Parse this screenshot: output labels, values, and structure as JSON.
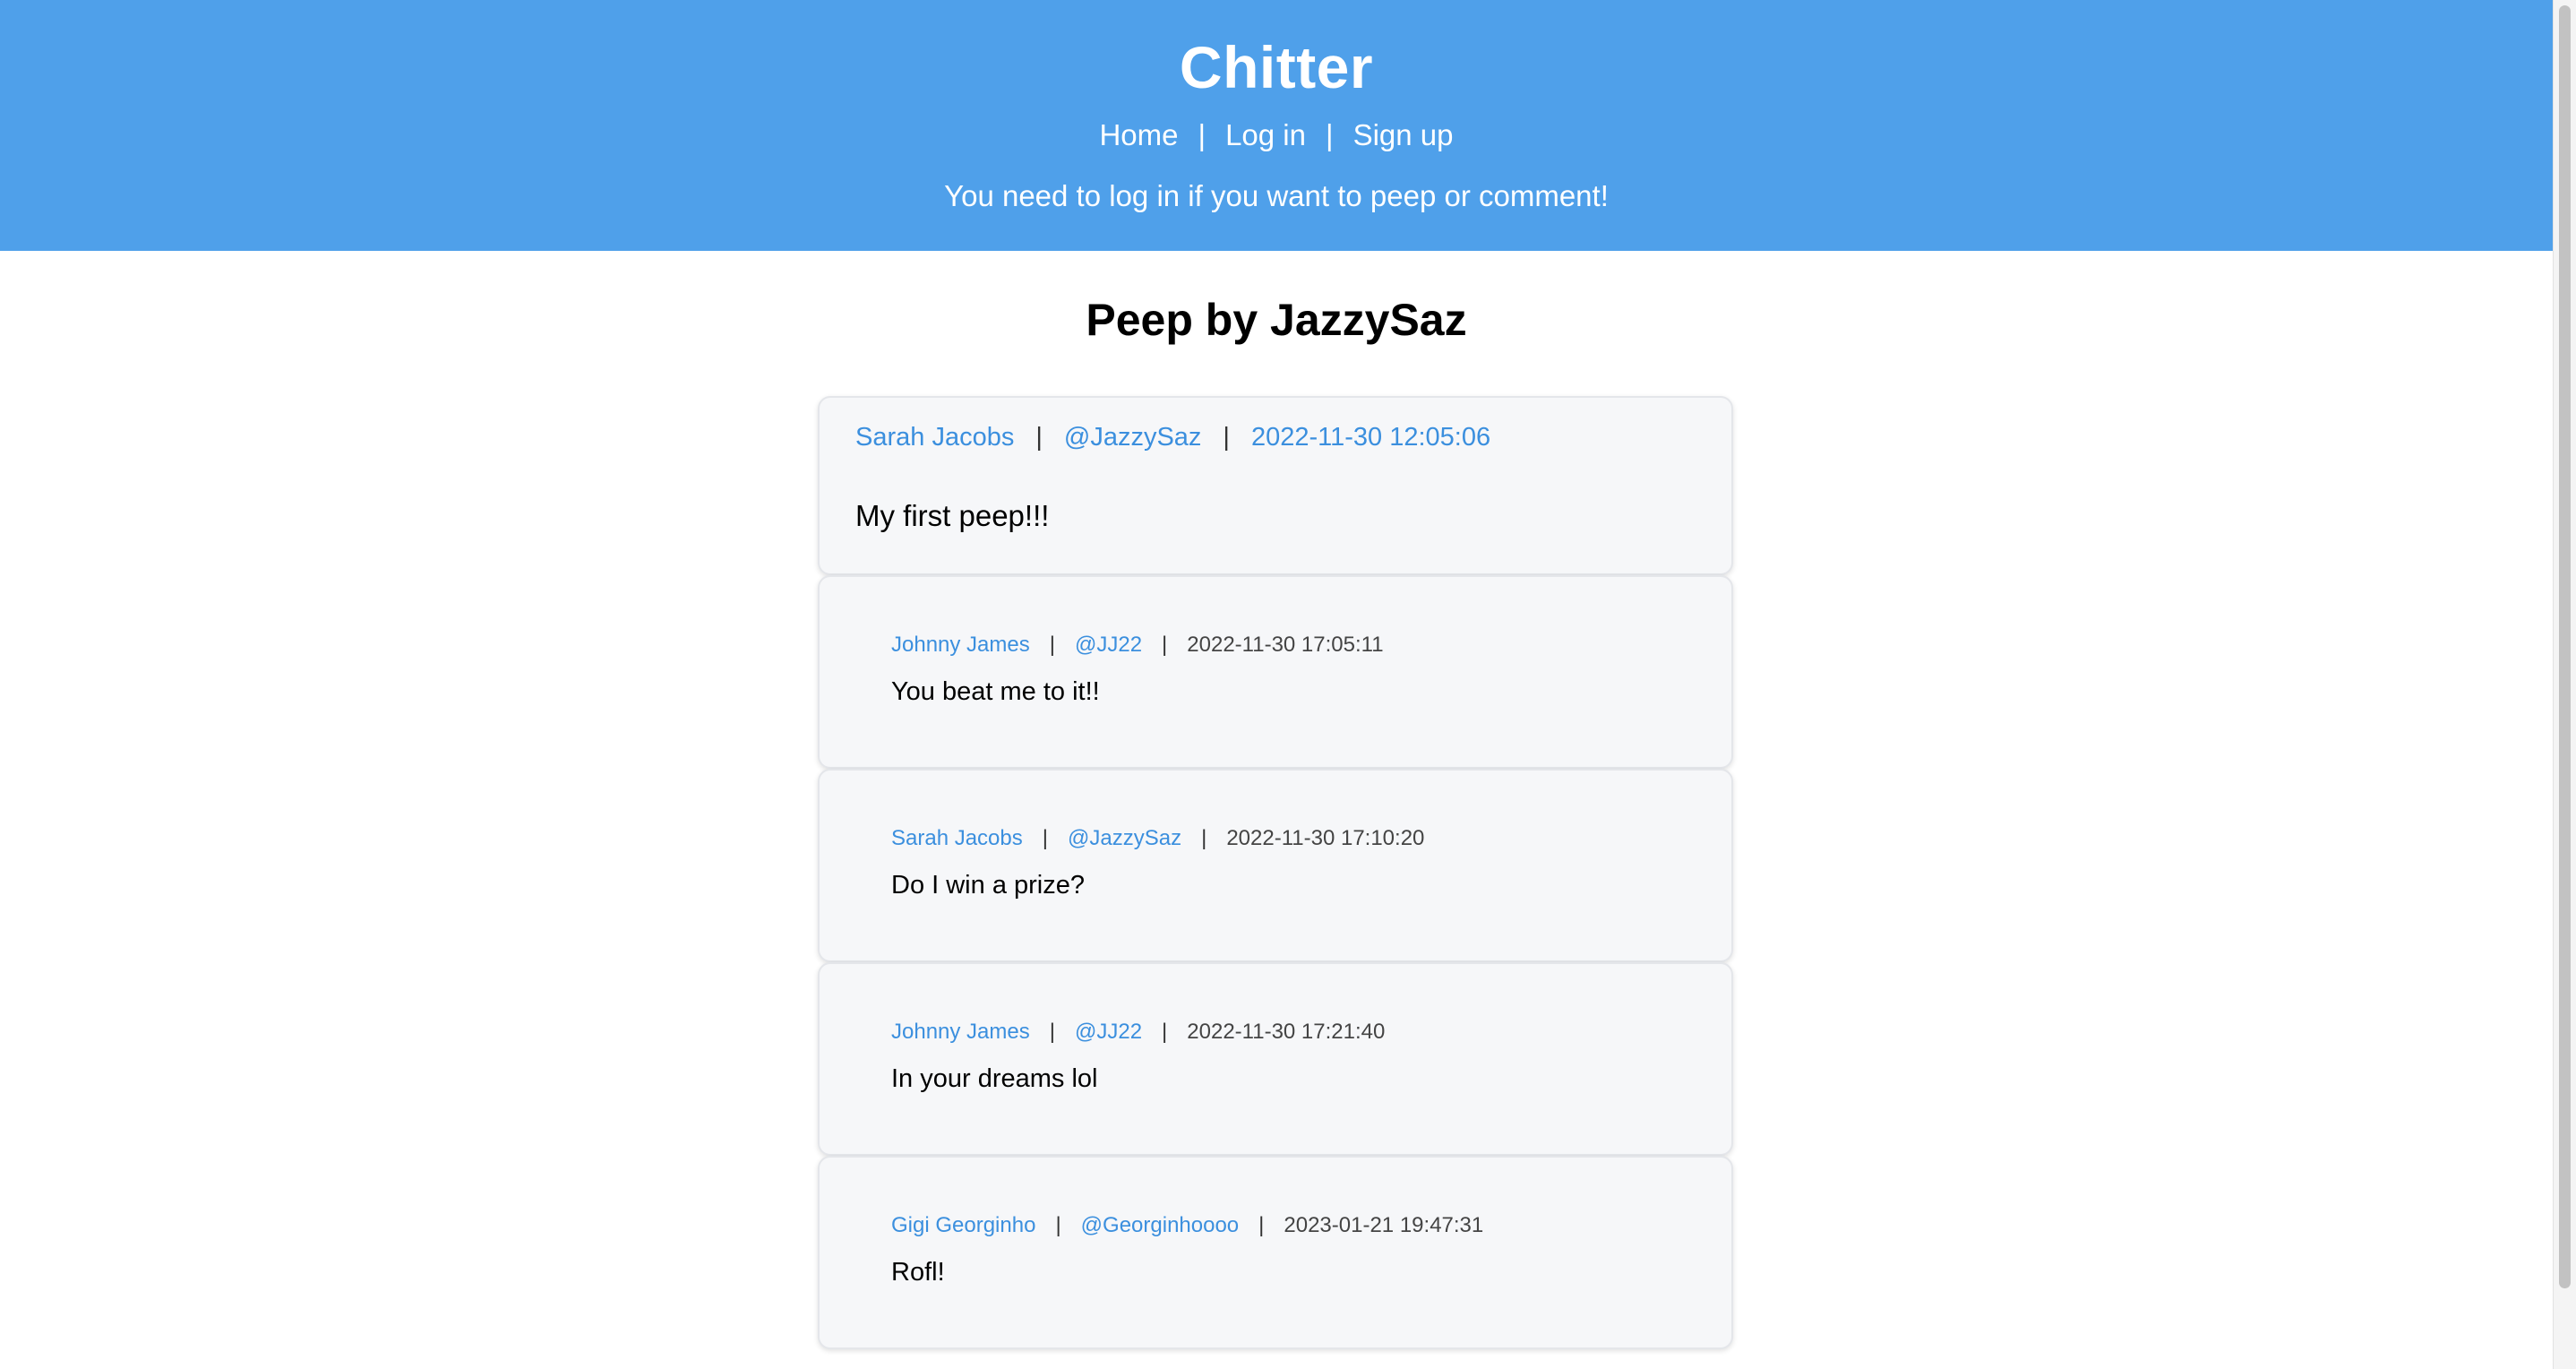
{
  "header": {
    "brand": "Chitter",
    "nav": [
      {
        "label": "Home"
      },
      {
        "label": "Log in"
      },
      {
        "label": "Sign up"
      }
    ],
    "nav_separator": "|",
    "login_notice": "You need to log in if you want to peep or comment!"
  },
  "main": {
    "title": "Peep by JazzySaz",
    "peep": {
      "author_name": "Sarah Jacobs",
      "author_handle": "@JazzySaz",
      "timestamp": "2022-11-30 12:05:06",
      "body": "My first peep!!!"
    },
    "comments": [
      {
        "author_name": "Johnny James",
        "author_handle": "@JJ22",
        "timestamp": "2022-11-30 17:05:11",
        "body": "You beat me to it!!"
      },
      {
        "author_name": "Sarah Jacobs",
        "author_handle": "@JazzySaz",
        "timestamp": "2022-11-30 17:10:20",
        "body": "Do I win a prize?"
      },
      {
        "author_name": "Johnny James",
        "author_handle": "@JJ22",
        "timestamp": "2022-11-30 17:21:40",
        "body": "In your dreams lol"
      },
      {
        "author_name": "Gigi Georginho",
        "author_handle": "@Georginhoooo",
        "timestamp": "2023-01-21 19:47:31",
        "body": "Rofl!"
      }
    ]
  },
  "colors": {
    "header_bg": "#4fa0ea",
    "link": "#3b8fde",
    "card_bg": "#f6f7f9"
  }
}
